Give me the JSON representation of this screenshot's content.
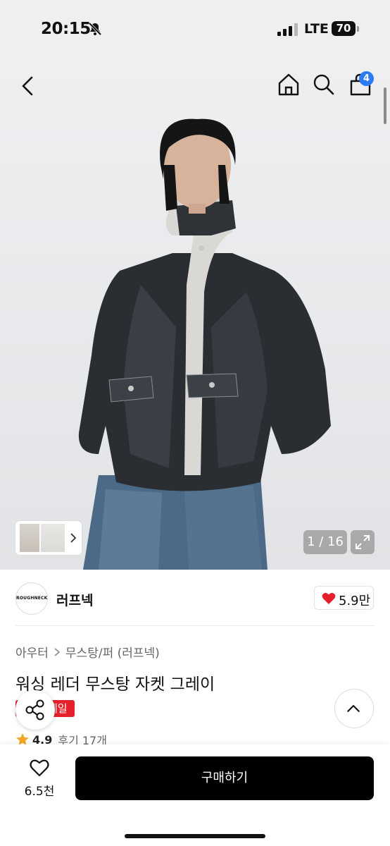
{
  "status_bar": {
    "time": "20:15",
    "network": "LTE",
    "battery": "70"
  },
  "header": {
    "cart_count": "4"
  },
  "gallery": {
    "counter": "1 / 16"
  },
  "brand": {
    "logo_text": "ROUGHNECK",
    "name": "러프넥",
    "likes": "5.9만"
  },
  "product": {
    "breadcrumb": [
      "아우터",
      "무스탕/퍼 (러프넥)"
    ],
    "title": "워싱 레더 무스탕 자켓 그레이",
    "badge": "세일",
    "rating": "4.9",
    "reviews": "후기 17개"
  },
  "bottom_bar": {
    "wish_count": "6.5천",
    "buy_label": "구매하기"
  },
  "colors": {
    "accent_blue": "#2b7bf4",
    "sale_red": "#e5202a",
    "heart_red": "#e5202a",
    "star": "#f5a623",
    "buy_button": "#000000"
  }
}
